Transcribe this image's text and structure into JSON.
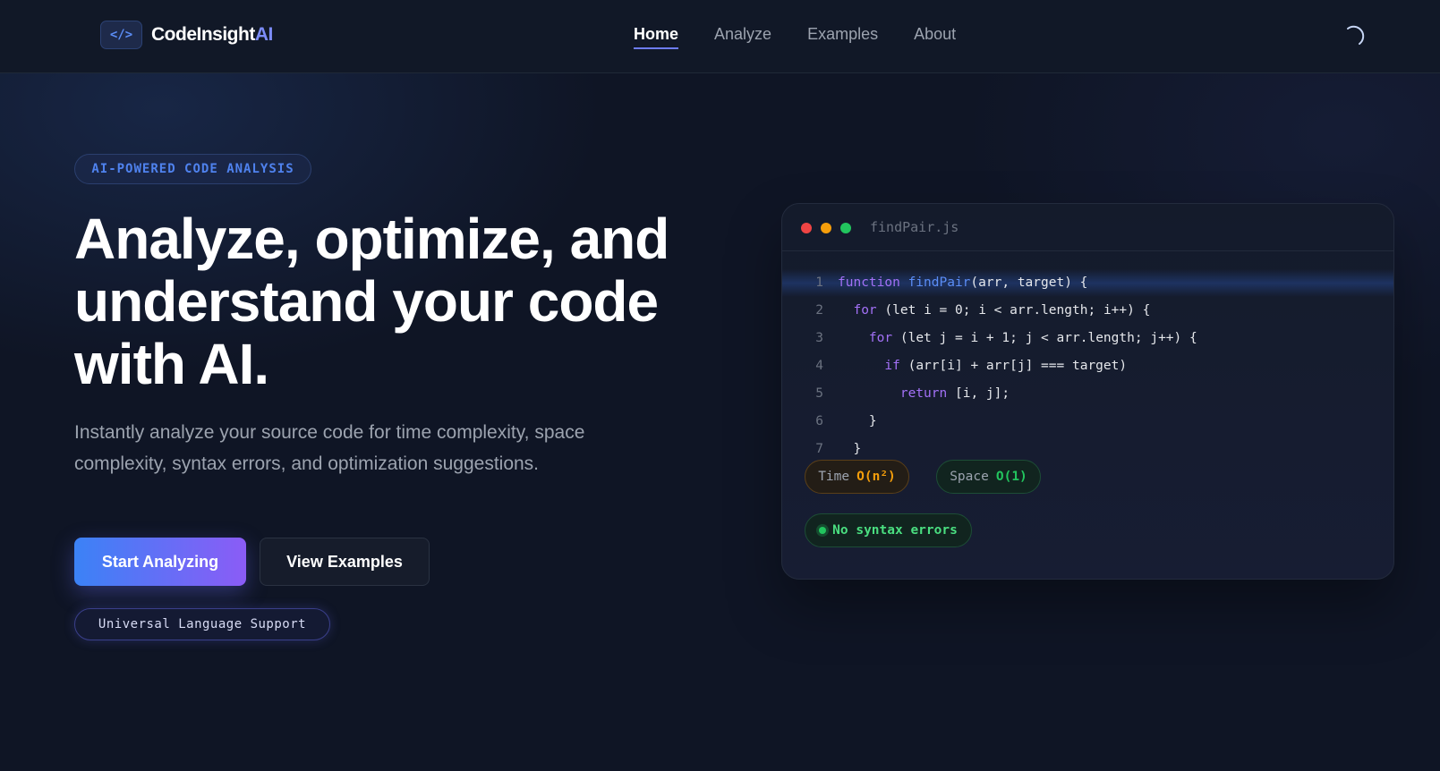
{
  "nav": {
    "logo_mark": "</>",
    "brand_main": "CodeInsight",
    "brand_accent": "AI",
    "links": [
      {
        "label": "Home",
        "active": true
      },
      {
        "label": "Analyze",
        "active": false
      },
      {
        "label": "Examples",
        "active": false
      },
      {
        "label": "About",
        "active": false
      }
    ],
    "theme_icon": "moon-icon"
  },
  "hero": {
    "badge": "AI-POWERED CODE ANALYSIS",
    "headline_line1": "Analyze, optimize, and",
    "headline_line2": "understand your code",
    "headline_line3": "with AI.",
    "subtitle": "Instantly analyze your source code for time complexity, space complexity, syntax errors, and optimization suggestions.",
    "primary_button": "Start Analyzing",
    "secondary_button": "View Examples",
    "language_pill": "Universal Language Support"
  },
  "code_card": {
    "filename": "findPair.js",
    "lines": [
      {
        "num": "1",
        "text": "function findPair(arr, target) {"
      },
      {
        "num": "2",
        "text": "  for (let i = 0; i < arr.length; i++) {"
      },
      {
        "num": "3",
        "text": "    for (let j = i + 1; j < arr.length; j++) {"
      },
      {
        "num": "4",
        "text": "      if (arr[i] + arr[j] === target)"
      },
      {
        "num": "5",
        "text": "        return [i, j];"
      },
      {
        "num": "6",
        "text": "    }"
      },
      {
        "num": "7",
        "text": "  }"
      }
    ],
    "time_label": "Time",
    "time_value": "O(n²)",
    "space_label": "Space",
    "space_value": "O(1)",
    "syntax_status": "No syntax errors"
  },
  "colors": {
    "background": "#0f1525",
    "accent_blue": "#3b82f6",
    "accent_purple": "#8b5cf6",
    "time_color": "#f59e0b",
    "success_color": "#22c55e"
  }
}
